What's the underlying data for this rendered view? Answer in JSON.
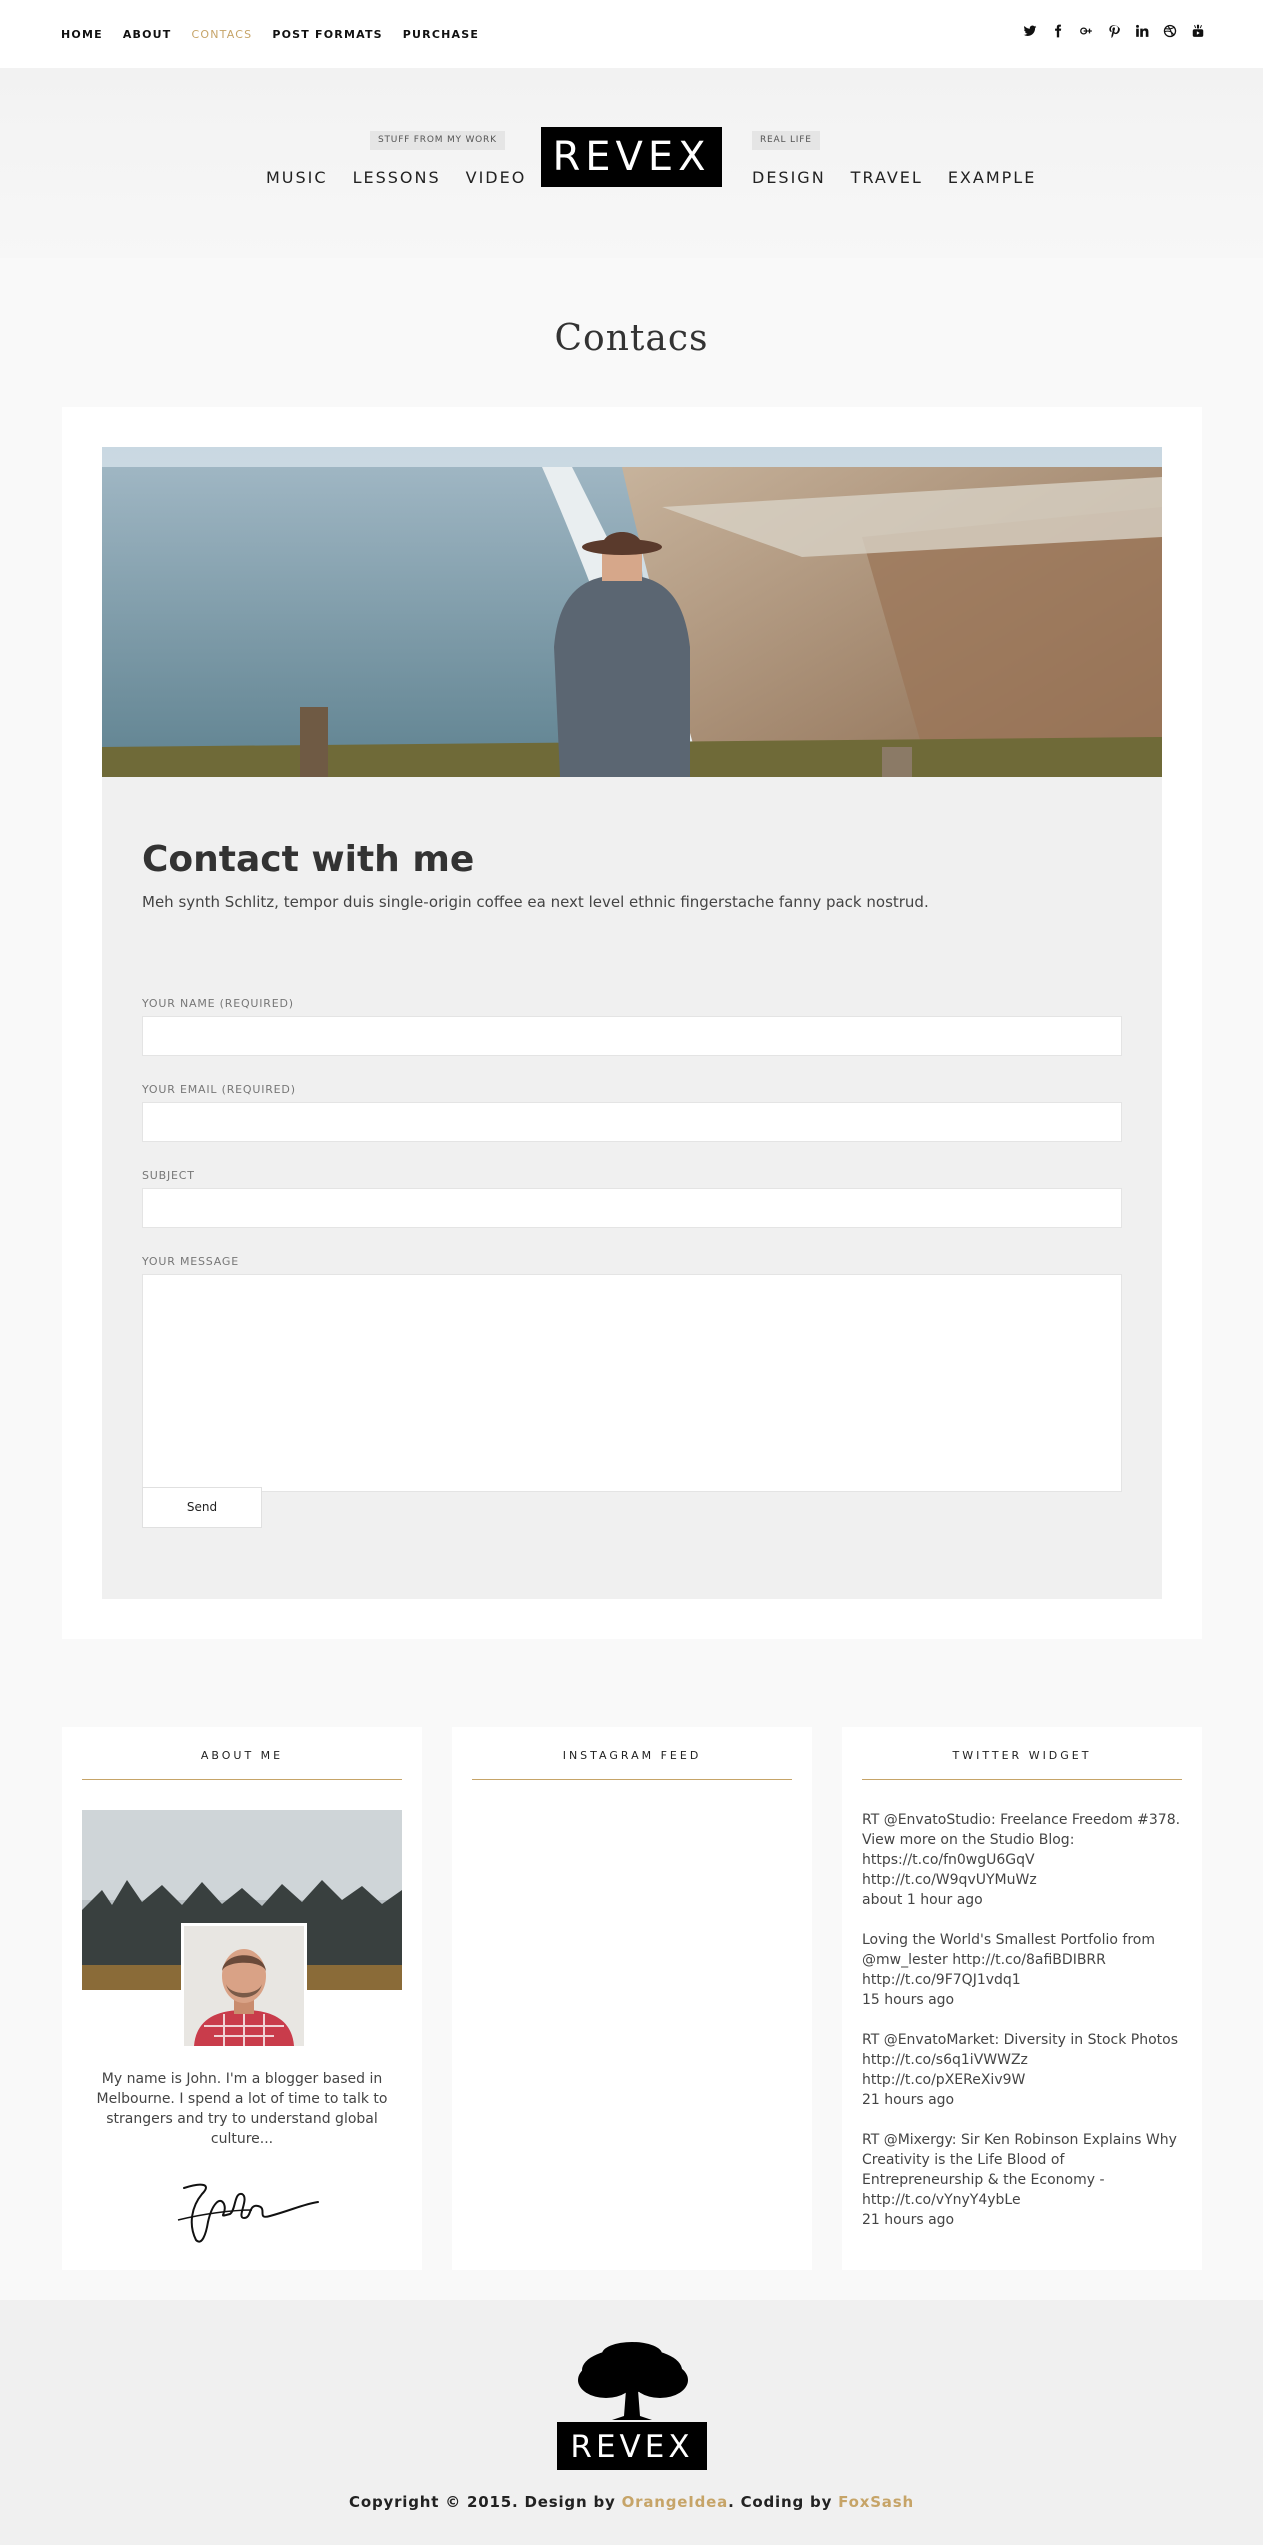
{
  "topnav": {
    "items": [
      "HOME",
      "ABOUT",
      "CONTACS",
      "POST FORMATS",
      "PURCHASE"
    ],
    "active_index": 2
  },
  "social": {
    "icons": [
      "twitter-icon",
      "facebook-icon",
      "google-plus-icon",
      "pinterest-icon",
      "linkedin-icon",
      "dribbble-icon",
      "youtube-icon"
    ],
    "glyphs": [
      "t",
      "f",
      "g+",
      "p",
      "in",
      "◎",
      "▶"
    ]
  },
  "header": {
    "logo": "REVEX",
    "left_tag": "STUFF FROM MY WORK",
    "right_tag": "REAL LIFE",
    "left_nav": [
      "MUSIC",
      "LESSONS",
      "VIDEO"
    ],
    "right_nav": [
      "DESIGN",
      "TRAVEL",
      "EXAMPLE"
    ]
  },
  "page": {
    "title": "Contacs"
  },
  "contact": {
    "title": "Contact with me",
    "description": "Meh synth Schlitz, tempor duis single-origin coffee ea next level ethnic fingerstache fanny pack nostrud.",
    "fields": {
      "name_label": "YOUR NAME (REQUIRED)",
      "email_label": "YOUR EMAIL (REQUIRED)",
      "subject_label": "SUBJECT",
      "message_label": "YOUR MESSAGE",
      "name_value": "",
      "email_value": "",
      "subject_value": "",
      "message_value": ""
    },
    "send_label": "Send"
  },
  "widgets": {
    "about": {
      "title": "ABOUT ME",
      "text": "My name is John. I'm a blogger based in Melbourne. I spend a lot of time to talk to strangers and try to understand global culture..."
    },
    "instagram": {
      "title": "INSTAGRAM FEED"
    },
    "twitter": {
      "title": "TWITTER WIDGET",
      "tweets": [
        {
          "text": "RT @EnvatoStudio: Freelance Freedom #378. View more on the Studio Blog: https://t.co/fn0wgU6GqV http://t.co/W9qvUYMuWz",
          "time": "about 1 hour ago"
        },
        {
          "text": "Loving the World's Smallest Portfolio from @mw_lester http://t.co/8afiBDIBRR http://t.co/9F7QJ1vdq1",
          "time": "15 hours ago"
        },
        {
          "text": "RT @EnvatoMarket: Diversity in Stock Photos http://t.co/s6q1iVWWZz http://t.co/pXEReXiv9W",
          "time": "21 hours ago"
        },
        {
          "text": "RT @Mixergy: Sir Ken Robinson Explains Why Creativity is the Life Blood of Entrepreneurship & the Economy - http://t.co/vYnyY4ybLe",
          "time": "21 hours ago"
        }
      ]
    }
  },
  "footer": {
    "logo": "REVEX",
    "copyright_prefix": "Copyright © 2015. Design by ",
    "design_by": "OrangeIdea",
    "middle": ". Coding by ",
    "coding_by": "FoxSash"
  },
  "colors": {
    "accent": "#c6a468",
    "logo_bg": "#000000"
  }
}
